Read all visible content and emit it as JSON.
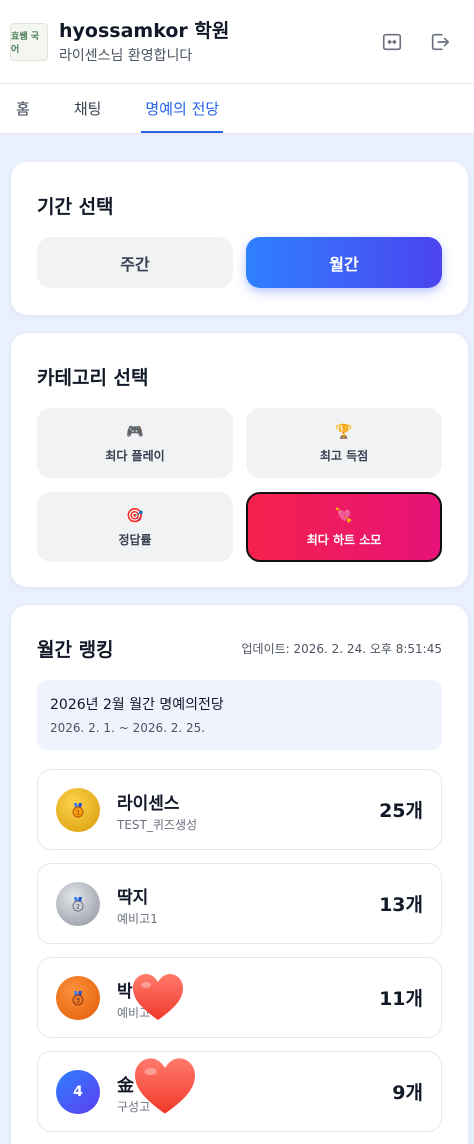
{
  "header": {
    "logo_text": "효쌤 국어",
    "title": "hyossamkor 학원",
    "subtitle": "라이센스님 환영합니다",
    "fullscreen_icon": "fullscreen-icon",
    "logout_icon": "logout-icon"
  },
  "tabs": [
    {
      "label": "홈",
      "active": false
    },
    {
      "label": "채팅",
      "active": false
    },
    {
      "label": "명예의 전당",
      "active": true
    }
  ],
  "period_select": {
    "title": "기간 선택",
    "options": [
      {
        "label": "주간",
        "selected": false
      },
      {
        "label": "월간",
        "selected": true
      }
    ]
  },
  "category_select": {
    "title": "카테고리 선택",
    "options": [
      {
        "icon": "🎮",
        "icon_name": "game-controller-icon",
        "label": "최다 플레이",
        "selected": false
      },
      {
        "icon": "🏆",
        "icon_name": "trophy-icon",
        "label": "최고 득점",
        "selected": false
      },
      {
        "icon": "🎯",
        "icon_name": "target-icon",
        "label": "정답률",
        "selected": false
      },
      {
        "icon": "💘",
        "icon_name": "heart-icon",
        "label": "최다 하트 소모",
        "selected": true
      }
    ]
  },
  "ranking": {
    "title": "월간 랭킹",
    "updated": "업데이트: 2026. 2. 24. 오후 8:51:45",
    "period_title": "2026년 2월 월간 명예의전당",
    "period_range": "2026. 2. 1. ~ 2026. 2. 25.",
    "rows": [
      {
        "rank": "1",
        "name": "라이센스",
        "sub": "TEST_퀴즈생성",
        "value": "25개",
        "badge": "gold-medal-icon"
      },
      {
        "rank": "2",
        "name": "딱지",
        "sub": "예비고1",
        "value": "13개",
        "badge": "silver-medal-icon"
      },
      {
        "rank": "3",
        "name": "박",
        "sub": "예비고",
        "value": "11개",
        "badge": "bronze-medal-icon"
      },
      {
        "rank": "4",
        "name": "金",
        "sub": "구성고",
        "value": "9개",
        "badge": "rank-number-badge"
      }
    ]
  },
  "colors": {
    "accent_blue": "#2563eb",
    "selected_gradient_start": "#2f80ff",
    "selected_gradient_end": "#4b44ef",
    "heart_gradient_start": "#f5214b",
    "heart_gradient_end": "#e6127a",
    "background": "#eaf0fd"
  }
}
